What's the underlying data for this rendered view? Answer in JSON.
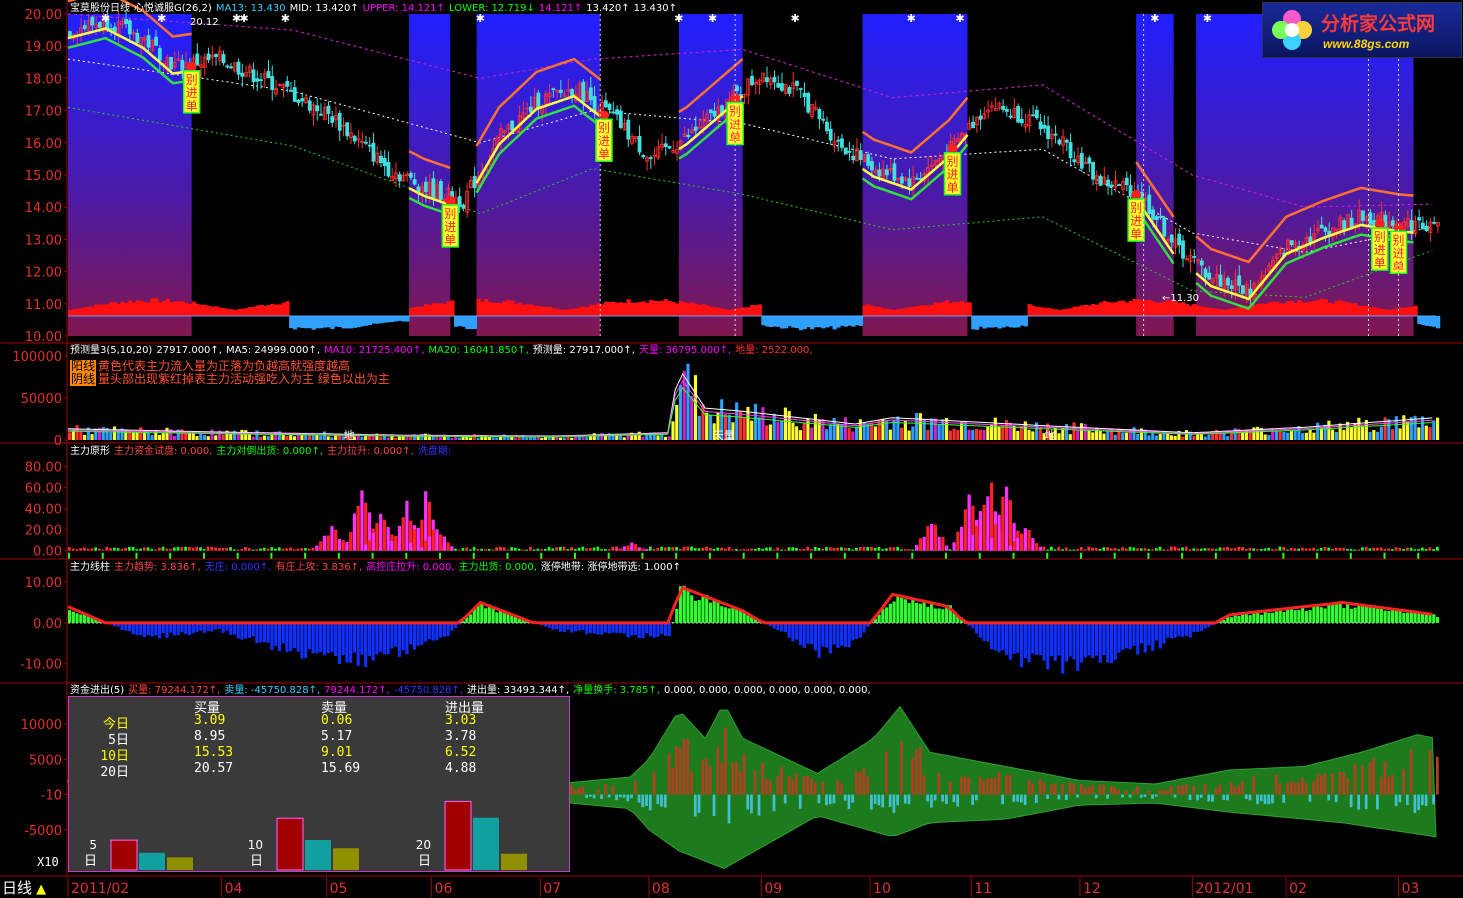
{
  "window": {
    "period_tab": "日线"
  },
  "logo": {
    "name": "分析家公式网",
    "url": "www.88gs.com"
  },
  "panel_main": {
    "header": [
      {
        "text": "宝莫股份日线",
        "color": "#ffffff"
      },
      {
        "text": "心悦诚服G(26,2)",
        "color": "#ffffff"
      },
      {
        "text": "MA13: 13.430",
        "color": "#3cf"
      },
      {
        "text": "MID: 13.420↑",
        "color": "#fff"
      },
      {
        "text": "UPPER: 14.121↑",
        "color": "#f0f"
      },
      {
        "text": "LOWER: 12.719↓",
        "color": "#0f0"
      },
      {
        "text": "14.121↑",
        "color": "#f0f"
      },
      {
        "text": "13.420↑",
        "color": "#fff"
      },
      {
        "text": "13.430↑",
        "color": "#fff"
      }
    ],
    "annotations": [
      "20.12",
      "11.30"
    ],
    "signal_text": "别进单"
  },
  "panel_volume": {
    "header": [
      {
        "text": "预测量3(5,10,20)",
        "color": "#fff"
      },
      {
        "text": "27917.000↑,",
        "color": "#fff"
      },
      {
        "text": "MA5: 24999.000↑,",
        "color": "#fff"
      },
      {
        "text": "MA10: 21725.400↑,",
        "color": "#f0f"
      },
      {
        "text": "MA20: 16041.850↑,",
        "color": "#0f0"
      },
      {
        "text": "预测量: 27917.000↑,",
        "color": "#fff"
      },
      {
        "text": "天量: 36795.000↑,",
        "color": "#f0f"
      },
      {
        "text": "地量: 2522.000,",
        "color": "#f33"
      }
    ],
    "notes": [
      {
        "tag": "阳线",
        "text": "黄色代表主力流入量为正落为负越高就强度越高"
      },
      {
        "tag": "阴线",
        "text": "量头部出现紫红掉表主力活动强吃入为主 绿色以出为主"
      }
    ],
    "labels": [
      "地",
      "天量",
      "地"
    ]
  },
  "panel_zlyx": {
    "header": [
      {
        "text": "主力原形",
        "color": "#fff"
      },
      {
        "text": "主力资金试盘: 0.000,",
        "color": "#f44"
      },
      {
        "text": "主力对倒出货: 0.000↑,",
        "color": "#0f0"
      },
      {
        "text": "主力拉升: 0.000↑,",
        "color": "#f44"
      },
      {
        "text": "洗盘期:",
        "color": "#33f"
      }
    ]
  },
  "panel_xz": {
    "header": [
      {
        "text": "主力线柱",
        "color": "#fff"
      },
      {
        "text": "主力趋势: 3.836↑,",
        "color": "#f44"
      },
      {
        "text": "无庄: 0.000↑,",
        "color": "#33f"
      },
      {
        "text": "有庄上攻: 3.836↑,",
        "color": "#f44"
      },
      {
        "text": "高控庄拉升: 0.000,",
        "color": "#f0f"
      },
      {
        "text": "主力出货: 0.000,",
        "color": "#0f0"
      },
      {
        "text": "涨停地带: 涨停地带选: 1.000↑",
        "color": "#fff"
      }
    ]
  },
  "panel_zj": {
    "header": [
      {
        "text": "资金进出(5)",
        "color": "#fff"
      },
      {
        "text": "买量: 79244.172↑,",
        "color": "#f44"
      },
      {
        "text": "卖量: -45750.828↑,",
        "color": "#3cf"
      },
      {
        "text": "79244.172↑,",
        "color": "#f0f"
      },
      {
        "text": "-45750.828↑,",
        "color": "#33f"
      },
      {
        "text": "进出量: 33493.344↑,",
        "color": "#fff"
      },
      {
        "text": "净量换手: 3.785↑,",
        "color": "#0f0"
      },
      {
        "text": "0.000, 0.000, 0.000, 0.000, 0.000, 0.000,",
        "color": "#fff"
      }
    ],
    "table": {
      "columns": [
        "买量",
        "卖量",
        "进出量"
      ],
      "rows": [
        {
          "label": "今日",
          "buy": "3.09",
          "sell": "0.06",
          "net": "3.03",
          "color": "#ff0"
        },
        {
          "label": "5日",
          "buy": "8.95",
          "sell": "5.17",
          "net": "3.78",
          "color": "#fff"
        },
        {
          "label": "10日",
          "buy": "15.53",
          "sell": "9.01",
          "net": "6.52",
          "color": "#ff0"
        },
        {
          "label": "20日",
          "buy": "20.57",
          "sell": "15.69",
          "net": "4.88",
          "color": "#fff"
        }
      ],
      "groups": [
        {
          "label": "5日",
          "bars": [
            8.95,
            5.17,
            3.78
          ]
        },
        {
          "label": "10日",
          "bars": [
            15.53,
            9.01,
            6.52
          ]
        },
        {
          "label": "20日",
          "bars": [
            20.57,
            15.69,
            4.88
          ]
        }
      ],
      "unit_label": "X10"
    }
  },
  "x_axis": {
    "labels": [
      "2011/02",
      "04",
      "05",
      "06",
      "07",
      "08",
      "09",
      "10",
      "11",
      "12",
      "2012/01",
      "02",
      "03"
    ]
  },
  "chart_data": [
    {
      "type": "candlestick",
      "title": "宝莫股份日线",
      "ylim": [
        10.0,
        20.0
      ],
      "y_ticks": [
        "20.00",
        "19.00",
        "18.00",
        "17.00",
        "16.00",
        "15.00",
        "14.00",
        "13.00",
        "12.00",
        "11.00",
        "10.00"
      ],
      "close_path": [
        [
          0,
          19.5
        ],
        [
          10,
          19.8
        ],
        [
          20,
          19.2
        ],
        [
          28,
          18.4
        ],
        [
          40,
          18.6
        ],
        [
          55,
          17.8
        ],
        [
          70,
          16.8
        ],
        [
          85,
          15.2
        ],
        [
          95,
          14.6
        ],
        [
          105,
          14.2
        ],
        [
          115,
          16.2
        ],
        [
          125,
          17.3
        ],
        [
          135,
          17.7
        ],
        [
          145,
          16.8
        ],
        [
          155,
          15.5
        ],
        [
          165,
          16.2
        ],
        [
          175,
          17.2
        ],
        [
          185,
          18.2
        ],
        [
          195,
          17.5
        ],
        [
          205,
          16.0
        ],
        [
          215,
          15.2
        ],
        [
          225,
          14.8
        ],
        [
          235,
          15.8
        ],
        [
          245,
          17.2
        ],
        [
          255,
          16.8
        ],
        [
          265,
          16.0
        ],
        [
          275,
          14.8
        ],
        [
          285,
          14.5
        ],
        [
          295,
          12.8
        ],
        [
          305,
          11.8
        ],
        [
          315,
          11.4
        ],
        [
          325,
          12.8
        ],
        [
          335,
          13.3
        ],
        [
          345,
          13.7
        ],
        [
          355,
          13.5
        ],
        [
          365,
          13.4
        ]
      ],
      "mid_path": [
        [
          0,
          18.6
        ],
        [
          60,
          17.6
        ],
        [
          110,
          16.0
        ],
        [
          140,
          17.0
        ],
        [
          180,
          16.6
        ],
        [
          220,
          15.5
        ],
        [
          260,
          15.8
        ],
        [
          300,
          13.2
        ],
        [
          330,
          12.6
        ],
        [
          365,
          13.4
        ]
      ],
      "upper_path": [
        [
          0,
          20.0
        ],
        [
          60,
          19.5
        ],
        [
          110,
          18.0
        ],
        [
          140,
          18.6
        ],
        [
          180,
          18.9
        ],
        [
          220,
          17.4
        ],
        [
          260,
          17.8
        ],
        [
          300,
          15.0
        ],
        [
          330,
          14.0
        ],
        [
          365,
          14.1
        ]
      ],
      "lower_path": [
        [
          0,
          17.1
        ],
        [
          60,
          15.9
        ],
        [
          110,
          13.8
        ],
        [
          140,
          15.2
        ],
        [
          180,
          14.4
        ],
        [
          220,
          13.3
        ],
        [
          260,
          13.7
        ],
        [
          300,
          11.4
        ],
        [
          330,
          11.2
        ],
        [
          365,
          12.7
        ]
      ],
      "blue_zones": [
        [
          0,
          33
        ],
        [
          91,
          102
        ],
        [
          109,
          142
        ],
        [
          163,
          180
        ],
        [
          212,
          240
        ],
        [
          285,
          295
        ],
        [
          301,
          359
        ]
      ],
      "signal_bars": [
        33,
        102,
        143,
        178,
        236,
        285,
        350,
        355
      ]
    },
    {
      "type": "bar",
      "title": "预测量3(5,10,20)",
      "ylim": [
        0,
        100000
      ],
      "y_ticks": [
        "100000",
        "50000",
        "0"
      ],
      "volume_path": [
        [
          0,
          14000
        ],
        [
          40,
          10000
        ],
        [
          90,
          6000
        ],
        [
          130,
          5000
        ],
        [
          160,
          9000
        ],
        [
          163,
          90000
        ],
        [
          170,
          40000
        ],
        [
          180,
          36000
        ],
        [
          210,
          20000
        ],
        [
          220,
          28000
        ],
        [
          260,
          18000
        ],
        [
          300,
          9000
        ],
        [
          330,
          16000
        ],
        [
          365,
          28000
        ]
      ]
    },
    {
      "type": "bar",
      "title": "主力原形",
      "ylim": [
        -5,
        90
      ],
      "y_ticks": [
        "80.00",
        "60.00",
        "40.00",
        "20.00",
        "0.00"
      ],
      "spikes": [
        [
          70,
          30
        ],
        [
          78,
          65
        ],
        [
          83,
          40
        ],
        [
          90,
          55
        ],
        [
          95,
          60
        ],
        [
          98,
          25
        ],
        [
          150,
          8
        ],
        [
          230,
          35
        ],
        [
          240,
          55
        ],
        [
          245,
          85
        ],
        [
          250,
          65
        ],
        [
          255,
          25
        ]
      ]
    },
    {
      "type": "bar",
      "title": "主力线柱",
      "ylim": [
        -14,
        12
      ],
      "y_ticks": [
        "10.00",
        "0.00",
        "-10.00"
      ],
      "trend_path": [
        [
          0,
          4
        ],
        [
          20,
          -4
        ],
        [
          40,
          -2
        ],
        [
          60,
          -8
        ],
        [
          80,
          -10
        ],
        [
          100,
          -4
        ],
        [
          110,
          5
        ],
        [
          130,
          -2
        ],
        [
          160,
          -4
        ],
        [
          163,
          9
        ],
        [
          180,
          3
        ],
        [
          200,
          -8
        ],
        [
          210,
          -5
        ],
        [
          220,
          7
        ],
        [
          235,
          4
        ],
        [
          250,
          -10
        ],
        [
          270,
          -12
        ],
        [
          290,
          -6
        ],
        [
          300,
          -3
        ],
        [
          310,
          2
        ],
        [
          340,
          5
        ],
        [
          365,
          2
        ]
      ]
    },
    {
      "type": "area",
      "title": "资金进出(5)",
      "ylim": [
        -11000,
        14000
      ],
      "y_ticks": [
        "10000",
        "5000",
        "0",
        "-5000",
        "-10"
      ],
      "upper_path": [
        [
          0,
          2000
        ],
        [
          130,
          1500
        ],
        [
          150,
          2500
        ],
        [
          155,
          5000
        ],
        [
          163,
          12000
        ],
        [
          170,
          8000
        ],
        [
          175,
          13000
        ],
        [
          180,
          8000
        ],
        [
          200,
          3000
        ],
        [
          215,
          8000
        ],
        [
          222,
          12500
        ],
        [
          230,
          6000
        ],
        [
          250,
          4000
        ],
        [
          270,
          2000
        ],
        [
          290,
          1500
        ],
        [
          310,
          3500
        ],
        [
          330,
          4000
        ],
        [
          345,
          6000
        ],
        [
          360,
          8500
        ],
        [
          365,
          8000
        ]
      ],
      "lower_path": [
        [
          0,
          -1500
        ],
        [
          130,
          -1000
        ],
        [
          150,
          -2000
        ],
        [
          155,
          -5000
        ],
        [
          163,
          -8000
        ],
        [
          175,
          -10500
        ],
        [
          190,
          -6000
        ],
        [
          200,
          -3000
        ],
        [
          220,
          -6000
        ],
        [
          230,
          -4000
        ],
        [
          250,
          -3500
        ],
        [
          270,
          -1500
        ],
        [
          290,
          -1200
        ],
        [
          310,
          -2500
        ],
        [
          340,
          -4000
        ],
        [
          365,
          -6000
        ]
      ]
    }
  ]
}
